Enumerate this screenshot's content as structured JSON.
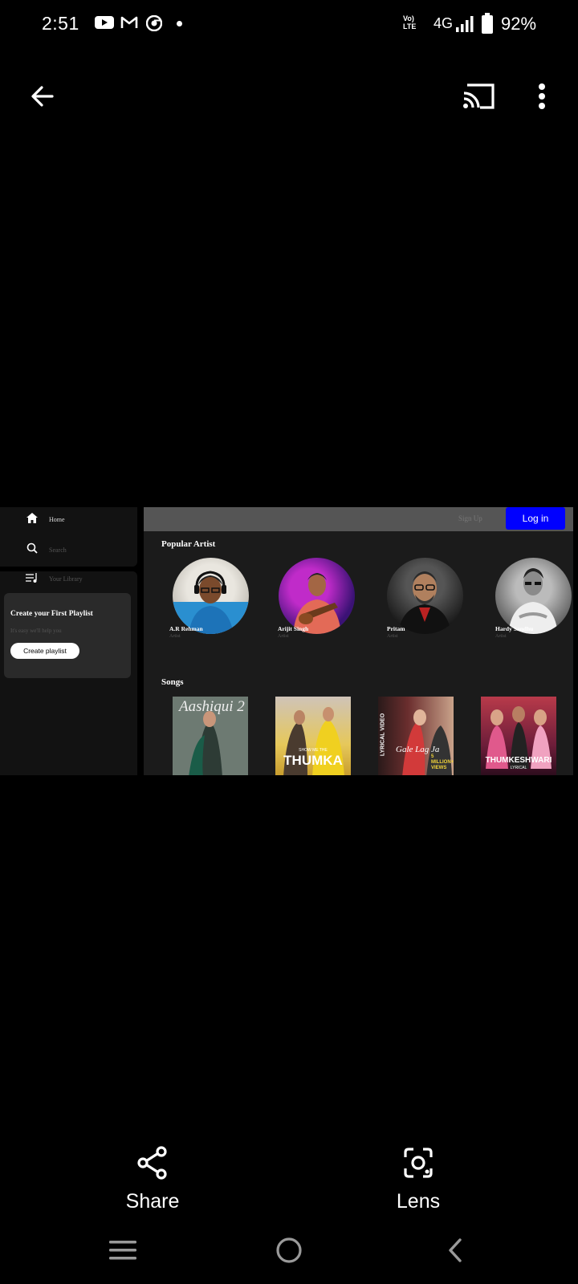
{
  "status_bar": {
    "time": "2:51",
    "network": "4G",
    "battery": "92%",
    "volte": "Vo) LTE"
  },
  "toolbar": {
    "back_icon": "arrow-left-icon",
    "cast_icon": "cast-icon",
    "more_icon": "more-vert-icon"
  },
  "screenshot": {
    "sidebar": {
      "items": [
        {
          "label": "Home",
          "icon": "home-icon"
        },
        {
          "label": "Search",
          "icon": "search-icon"
        },
        {
          "label": "Your Library",
          "icon": "library-icon"
        }
      ],
      "playlist_card": {
        "title": "Create your First Playlist",
        "subtitle": "It's easy we'll help you",
        "button": "Create playlist"
      }
    },
    "header": {
      "signup": "Sign Up",
      "login": "Log in"
    },
    "popular_artist": {
      "title": "Popular Artist",
      "artists": [
        {
          "name": "A.R Rehman",
          "role": "Artist"
        },
        {
          "name": "Arijit Singh",
          "role": "Artist"
        },
        {
          "name": "Pritam",
          "role": "Artist"
        },
        {
          "name": "Hardy Sandhu",
          "role": "Artist"
        }
      ]
    },
    "songs": {
      "title": "Songs",
      "items": [
        {
          "art_text": "Aashiqui 2"
        },
        {
          "art_text": "THUMKA",
          "art_top": "SHOW ME THE"
        },
        {
          "art_text": "Gale Lag Ja",
          "art_side": "LYRICAL VIDEO",
          "art_badge": "5 MILLION+ VIEWS"
        },
        {
          "art_text": "THUMKESHWARI",
          "art_sub": "LYRICAL"
        }
      ]
    }
  },
  "actions": {
    "share": "Share",
    "lens": "Lens"
  }
}
